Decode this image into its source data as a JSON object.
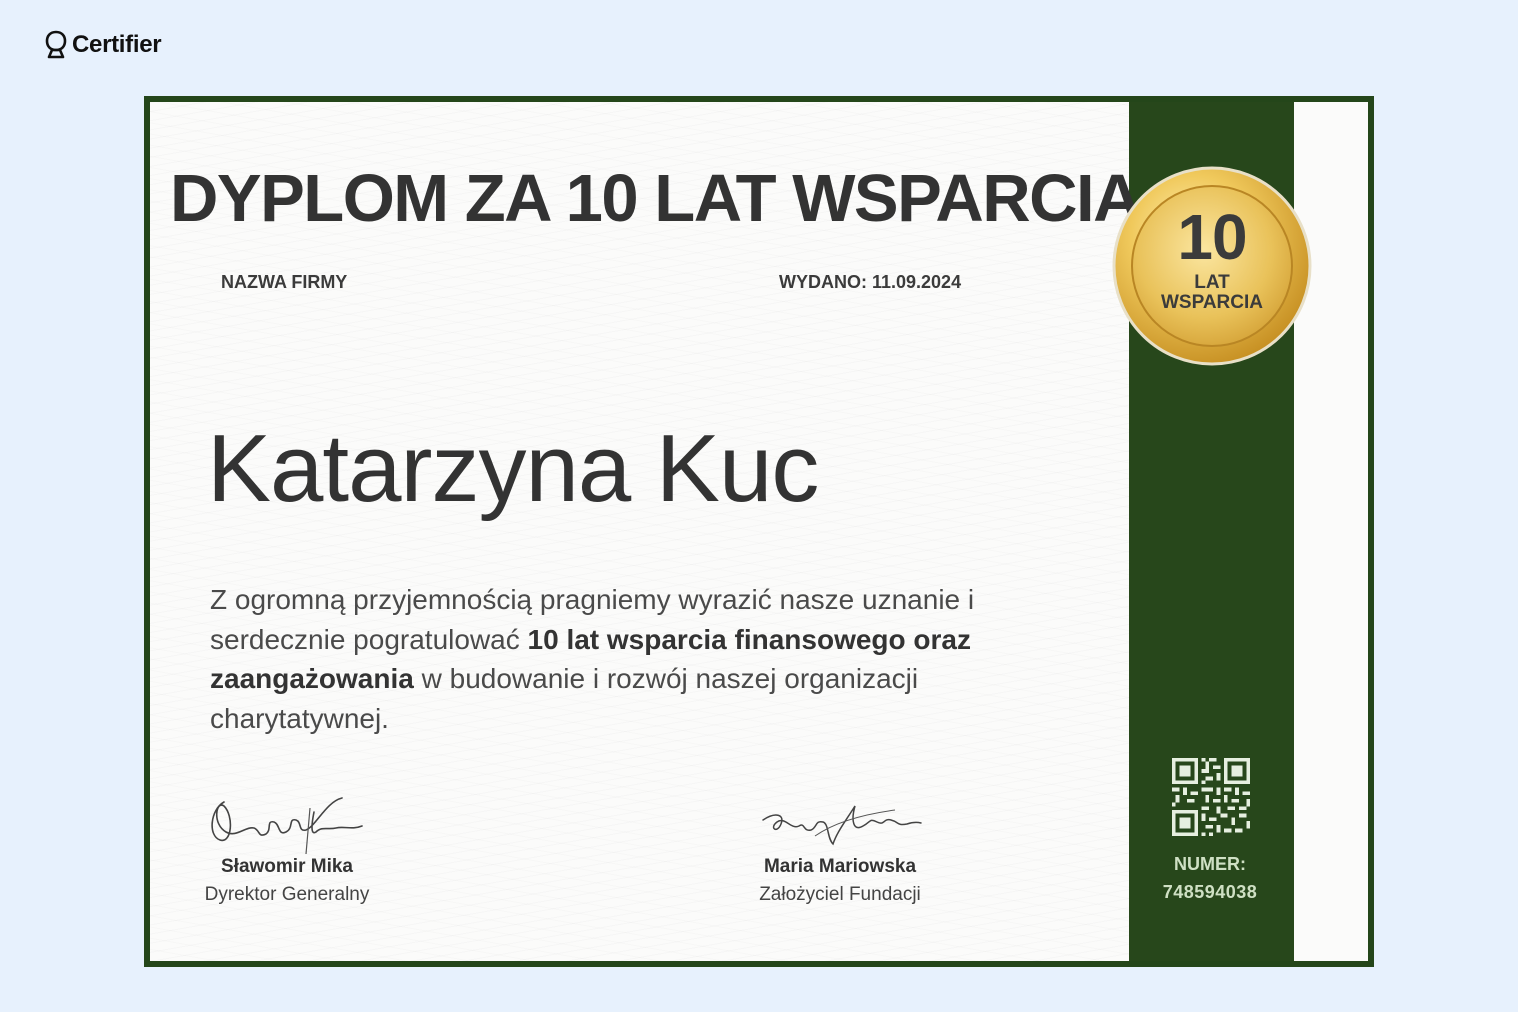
{
  "brand": {
    "name": "Certifier"
  },
  "certificate": {
    "title": "DYPLOM ZA 10 LAT WSPARCIA",
    "company": "NAZWA FIRMY",
    "issued": "WYDANO: 11.09.2024",
    "recipient": "Katarzyna Kuc",
    "description": {
      "part1": "Z ogromną przyjemnością pragniemy wyrazić nasze uznanie i serdecznie pogratulować ",
      "bold": "10 lat wsparcia finansowego oraz zaangażowania",
      "part2": " w budowanie i rozwój naszej organizacji charytatywnej."
    },
    "medal": {
      "number": "10",
      "line1": "LAT",
      "line2": "WSPARCIA"
    },
    "signatures": [
      {
        "name": "Sławomir Mika",
        "role": "Dyrektor Generalny"
      },
      {
        "name": "Maria Mariowska",
        "role": "Założyciel Fundacji"
      }
    ],
    "number_label": "NUMER:",
    "number_value": "748594038"
  },
  "colors": {
    "page_background": "#e7f1fd",
    "frame_green": "#27471b",
    "gold": "#d9a93a",
    "text_dark": "#333333"
  },
  "icons": {
    "brand": "certifier-logo-icon",
    "qr": "qr-code-icon",
    "medal": "gold-medal-badge"
  }
}
